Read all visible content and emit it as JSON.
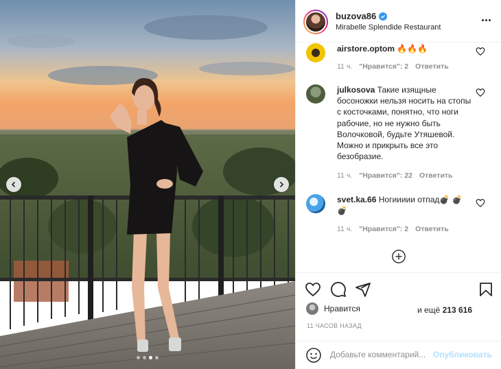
{
  "post": {
    "username": "buzova86",
    "location": "Mirabelle Splendide Restaurant",
    "photo_alt": "Woman in black dress on a rooftop terrace at sunset",
    "carousel": {
      "slide_count": 4,
      "active_index": 2
    }
  },
  "comments": [
    {
      "username": "airstore.optom",
      "text": "🔥🔥🔥",
      "time": "11 ч.",
      "likes": "\"Нравится\": 2",
      "reply": "Ответить"
    },
    {
      "username": "julkosova",
      "text": "Такие изящные босоножки нельзя носить на стопы с косточками, понятно, что ноги рабочие, но не нужно быть Волочковой, будьте Утяшевой. Можно и прикрыть все это безобразие.",
      "time": "11 ч.",
      "likes": "\"Нравится\": 22",
      "reply": "Ответить"
    },
    {
      "username": "svet.ka.66",
      "text": "Ногиииии отпад💣 💣 💣",
      "time": "11 ч.",
      "likes": "\"Нравится\": 2",
      "reply": "Ответить"
    }
  ],
  "actions": {
    "liked_by_prefix": "Нравится",
    "liked_by_suffix": "и ещё",
    "likes_count": "213 616",
    "timestamp": "11 ЧАСОВ НАЗАД"
  },
  "add_comment": {
    "placeholder": "Добавьте комментарий...",
    "publish_label": "Опубликовать"
  },
  "colors": {
    "verified": "#3897f0",
    "publish_disabled": "#b2dffc",
    "meta_gray": "#8e8e8e"
  }
}
